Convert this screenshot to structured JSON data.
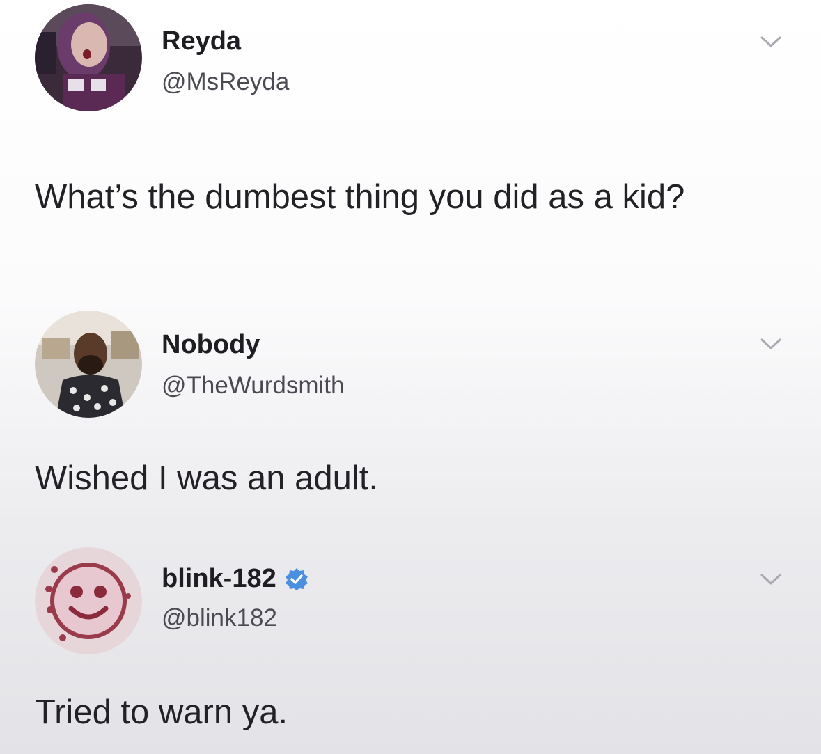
{
  "tweets": [
    {
      "name": "Reyda",
      "handle": "@MsReyda",
      "text": "What’s the dumbest thing you did as a kid?",
      "avatar_icon": "profile-photo-woman",
      "verified": false
    },
    {
      "name": "Nobody",
      "handle": "@TheWurdsmith",
      "text": "Wished I was an adult.",
      "avatar_icon": "profile-photo-man",
      "verified": false
    },
    {
      "name": "blink-182",
      "handle": "@blink182",
      "text": "Tried to warn ya.",
      "avatar_icon": "smiley-logo",
      "verified": true
    }
  ],
  "colors": {
    "verified_badge": "#4a90e2",
    "chevron": "#a8a8b0",
    "text": "#222226"
  },
  "icons": {
    "menu": "chevron-down-icon",
    "verified": "verified-badge-icon"
  }
}
